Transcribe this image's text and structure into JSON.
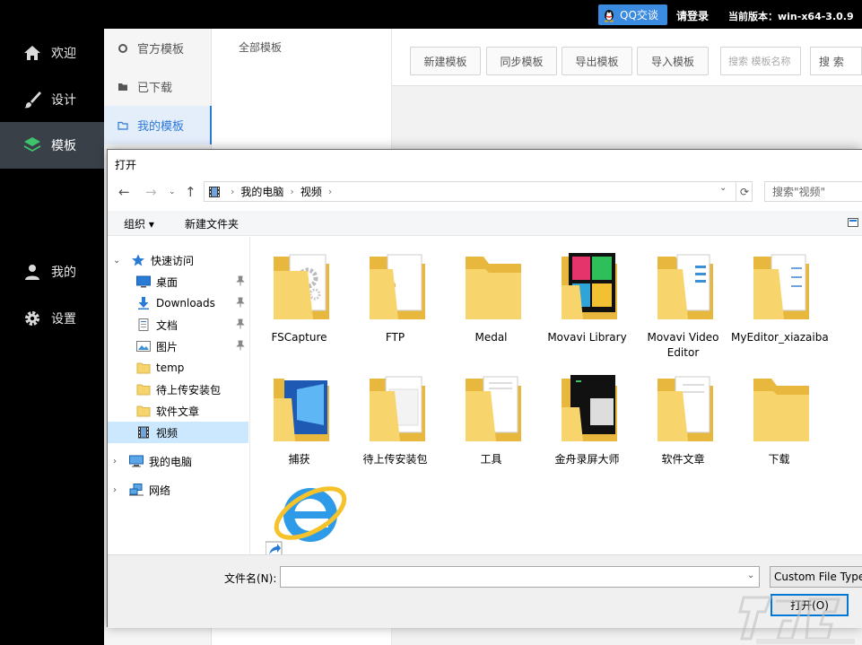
{
  "topbar": {
    "qq_login_label": "QQ交谈",
    "login_label": "请登录",
    "version_text": "当前版本：win-x64-3.0.9"
  },
  "left_nav": {
    "items": [
      {
        "label": "欢迎",
        "icon": "home-icon"
      },
      {
        "label": "设计",
        "icon": "brush-icon"
      },
      {
        "label": "模板",
        "icon": "layers-icon",
        "active": true
      },
      {
        "label": "我的",
        "icon": "user-icon"
      },
      {
        "label": "设置",
        "icon": "gear-icon"
      }
    ]
  },
  "sub_nav": {
    "items": [
      {
        "label": "官方模板",
        "icon": "circle-icon"
      },
      {
        "label": "已下载",
        "icon": "folder-icon"
      },
      {
        "label": "我的模板",
        "icon": "folder-outline-icon",
        "active": true
      }
    ]
  },
  "category": {
    "all_label": "全部模板"
  },
  "toolbar": {
    "buttons": [
      "新建模板",
      "同步模板",
      "导出模板",
      "导入模板"
    ],
    "search_placeholder": "搜索 模板名称",
    "search_button": "搜 索"
  },
  "dialog": {
    "title": "打开",
    "breadcrumb": [
      "我的电脑",
      "视频"
    ],
    "search_placeholder": "搜索\"视频\"",
    "organize_label": "组织",
    "new_folder_label": "新建文件夹",
    "tree": [
      {
        "label": "快速访问",
        "icon": "star-icon",
        "expanded": true
      },
      {
        "label": "桌面",
        "icon": "desktop-icon",
        "pinned": true
      },
      {
        "label": "Downloads",
        "icon": "download-icon",
        "pinned": true
      },
      {
        "label": "文档",
        "icon": "document-icon",
        "pinned": true
      },
      {
        "label": "图片",
        "icon": "picture-icon",
        "pinned": true
      },
      {
        "label": "temp",
        "icon": "folder-icon"
      },
      {
        "label": "待上传安装包",
        "icon": "folder-icon"
      },
      {
        "label": "软件文章",
        "icon": "folder-icon"
      },
      {
        "label": "视频",
        "icon": "video-icon",
        "selected": true
      },
      {
        "label": "我的电脑",
        "icon": "computer-icon"
      },
      {
        "label": "网络",
        "icon": "network-icon"
      }
    ],
    "files": [
      {
        "label": "FSCapture",
        "icon": "folder-gear-icon"
      },
      {
        "label": "FTP",
        "icon": "folder-doc-icon"
      },
      {
        "label": "Medal",
        "icon": "folder-icon"
      },
      {
        "label": "Movavi Library",
        "icon": "folder-media-icon"
      },
      {
        "label": "Movavi Video Editor",
        "icon": "folder-doc-icon"
      },
      {
        "label": "MyEditor_xiazaiba",
        "icon": "folder-doc-icon"
      },
      {
        "label": "捕获",
        "icon": "folder-windows-icon"
      },
      {
        "label": "待上传安装包",
        "icon": "folder-doc-icon"
      },
      {
        "label": "工具",
        "icon": "folder-doc-icon"
      },
      {
        "label": "金舟录屏大师",
        "icon": "folder-screen-icon"
      },
      {
        "label": "软件文章",
        "icon": "folder-doc-icon"
      },
      {
        "label": "下载",
        "icon": "folder-icon"
      },
      {
        "label": "",
        "icon": "internet-explorer-shortcut-icon"
      }
    ],
    "filename_label": "文件名(N):",
    "filename_value": "",
    "file_type": "Custom File Type",
    "open_button": "打开(O)"
  },
  "colors": {
    "accent": "#2c79d6",
    "nav_bg": "#000000",
    "folder": "#f7d56c",
    "selection": "#cce8ff"
  }
}
